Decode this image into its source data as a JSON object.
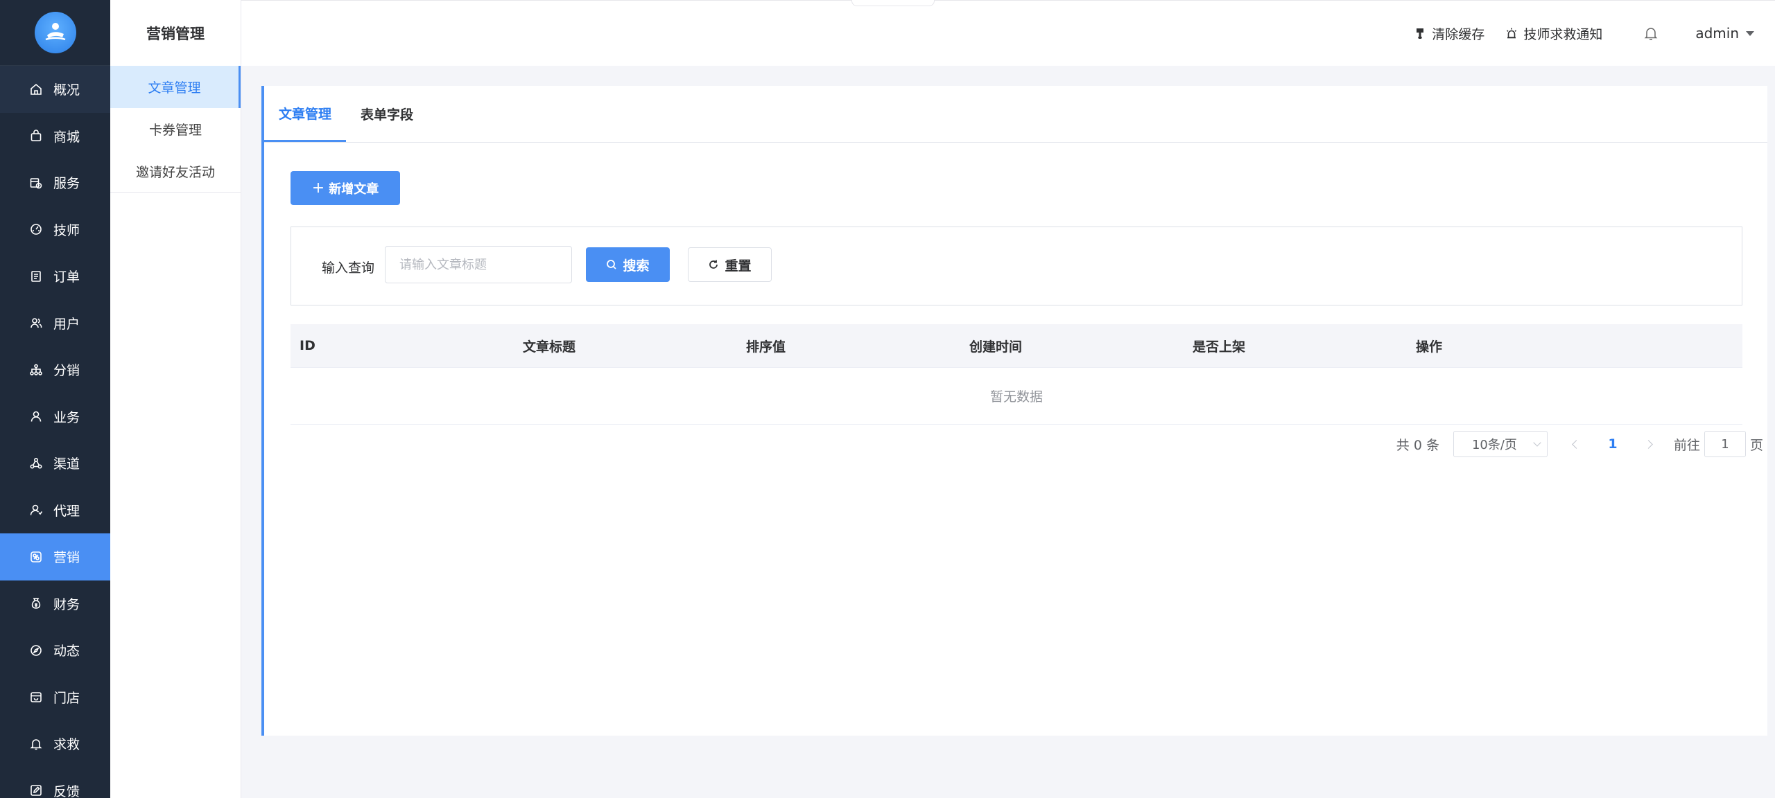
{
  "sidebar": {
    "items": [
      {
        "label": "概况",
        "icon": "home-icon"
      },
      {
        "label": "商城",
        "icon": "shopping-bag-icon"
      },
      {
        "label": "服务",
        "icon": "service-calendar-icon"
      },
      {
        "label": "技师",
        "icon": "dashboard-icon"
      },
      {
        "label": "订单",
        "icon": "document-icon"
      },
      {
        "label": "用户",
        "icon": "users-icon"
      },
      {
        "label": "分销",
        "icon": "network-icon"
      },
      {
        "label": "业务",
        "icon": "user-icon"
      },
      {
        "label": "渠道",
        "icon": "channel-icon"
      },
      {
        "label": "代理",
        "icon": "agent-icon"
      },
      {
        "label": "营销",
        "icon": "marketing-icon"
      },
      {
        "label": "财务",
        "icon": "money-bag-icon"
      },
      {
        "label": "动态",
        "icon": "compass-icon"
      },
      {
        "label": "门店",
        "icon": "store-icon"
      },
      {
        "label": "求救",
        "icon": "bell-icon"
      },
      {
        "label": "反馈",
        "icon": "edit-icon"
      }
    ],
    "active_index": 10
  },
  "subsidebar": {
    "title": "营销管理",
    "items": [
      "文章管理",
      "卡券管理",
      "邀请好友活动"
    ],
    "active_index": 0
  },
  "header": {
    "clear_cache": "清除缓存",
    "sos_notice": "技师求救通知",
    "user": "admin"
  },
  "tabs": [
    "文章管理",
    "表单字段"
  ],
  "actions": {
    "add_article": "新增文章"
  },
  "filter": {
    "label": "输入查询",
    "placeholder": "请输入文章标题",
    "search": "搜索",
    "reset": "重置"
  },
  "table": {
    "columns": [
      "ID",
      "文章标题",
      "排序值",
      "创建时间",
      "是否上架",
      "操作"
    ],
    "empty": "暂无数据"
  },
  "pagination": {
    "total": "共 0 条",
    "page_size": "10条/页",
    "current_page": "1",
    "goto_prefix": "前往",
    "goto_value": "1",
    "goto_suffix": "页"
  },
  "colors": {
    "sidebar_bg": "#1f2a3a",
    "accent": "#4a8ff3",
    "sub_active_bg": "#d9ebfd",
    "page_bg": "#f4f5f9"
  }
}
